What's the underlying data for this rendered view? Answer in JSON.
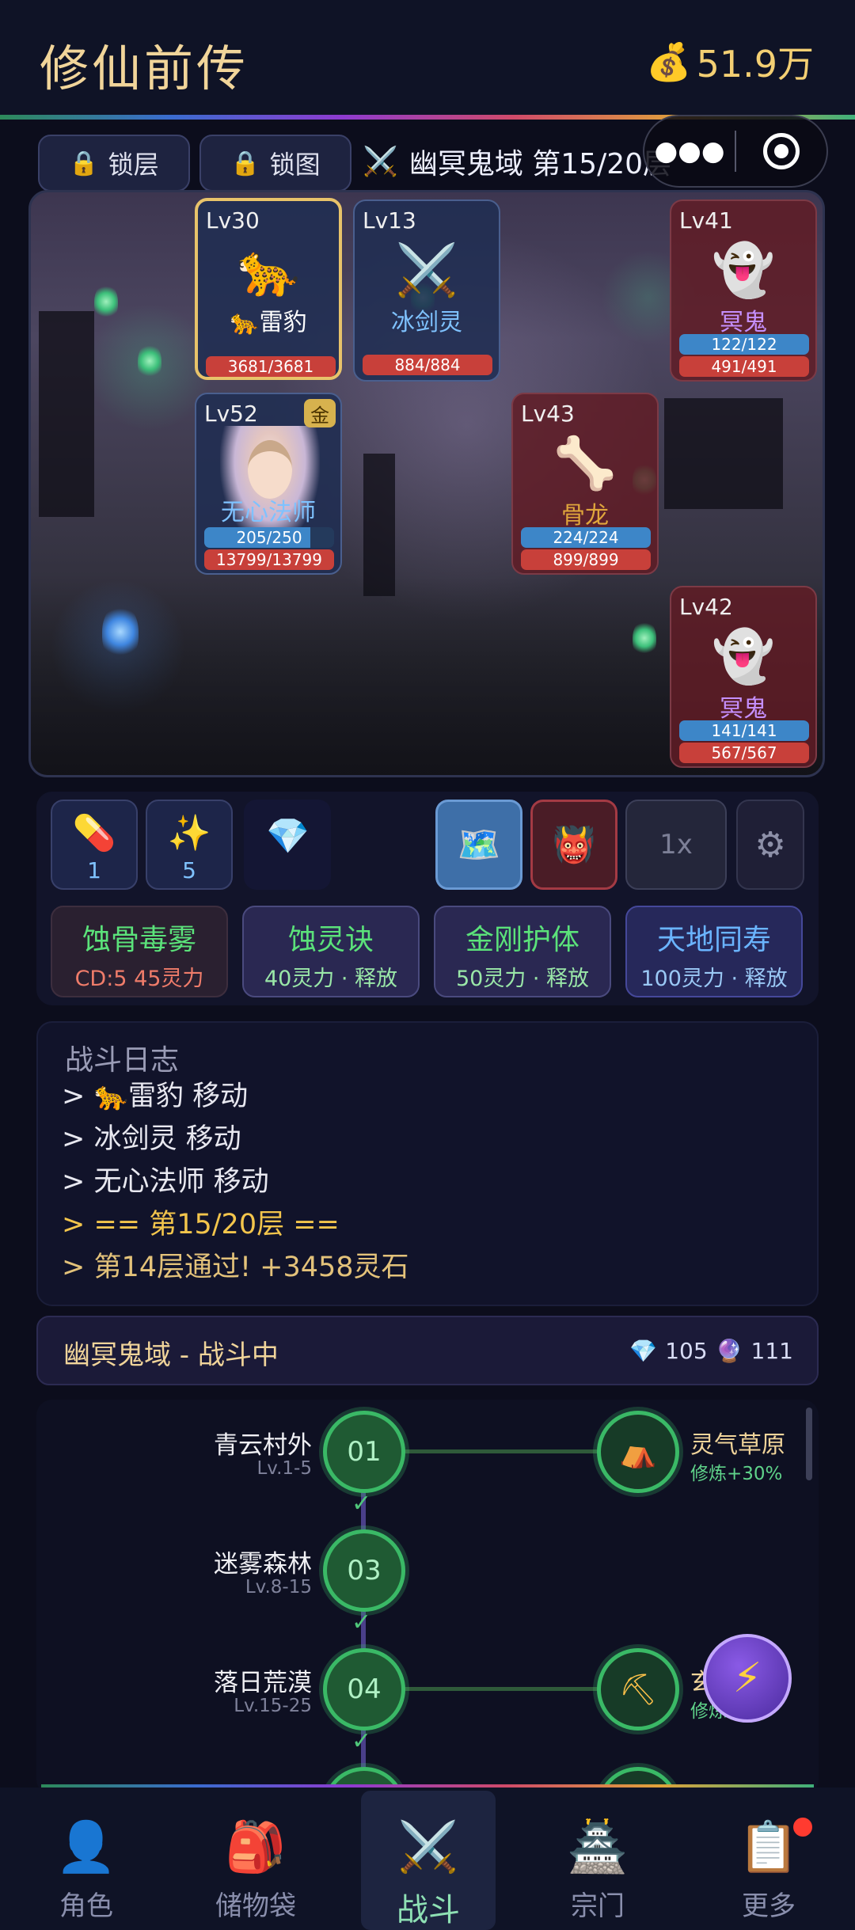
{
  "header": {
    "title": "修仙前传",
    "money_icon": "money-bag-icon",
    "money": "51.9万"
  },
  "controls": {
    "lock_floor": "锁层",
    "lock_map": "锁图",
    "level_title": "幽冥鬼域 第15/20层"
  },
  "units": [
    {
      "lv": "Lv30",
      "icon": "🐆",
      "name": "🐆雷豹",
      "hp": "3681/3681",
      "side": "ally"
    },
    {
      "lv": "Lv13",
      "icon": "⚔️",
      "name": "冰剑灵",
      "hp": "884/884",
      "side": "ally"
    },
    {
      "lv": "Lv41",
      "icon": "👻",
      "name": "冥鬼",
      "mp": "122/122",
      "hp": "491/491",
      "side": "enemy"
    },
    {
      "lv": "Lv52",
      "badge": "金",
      "name": "无心法师",
      "mp": "205/250",
      "hp": "13799/13799",
      "mp_frac": 0.82,
      "side": "ally"
    },
    {
      "lv": "Lv43",
      "icon": "🦴",
      "name": "骨龙",
      "mp": "224/224",
      "hp": "899/899",
      "side": "enemy"
    },
    {
      "lv": "Lv42",
      "icon": "👻",
      "name": "冥鬼",
      "mp": "141/141",
      "hp": "567/567",
      "side": "enemy"
    }
  ],
  "items": [
    {
      "icon": "💊",
      "count": "1"
    },
    {
      "icon": "✨",
      "count": "5"
    }
  ],
  "speed": "1x",
  "skills": [
    {
      "name": "蚀骨毒雾",
      "cost": "CD:5  45灵力"
    },
    {
      "name": "蚀灵诀",
      "cost": "40灵力 · 释放"
    },
    {
      "name": "金刚护体",
      "cost": "50灵力 · 释放"
    },
    {
      "name": "天地同寿",
      "cost": "100灵力 · 释放"
    }
  ],
  "log": {
    "title": "战斗日志",
    "lines": [
      "> 🐆雷豹 移动",
      "> 冰剑灵 移动",
      "> 无心法师 移动",
      "> == 第15/20层 ==",
      "> 第14层通过! +3458灵石"
    ]
  },
  "status": {
    "text": "幽冥鬼域 - 战斗中",
    "gems": "105",
    "orbs": "111"
  },
  "map": {
    "zones": [
      {
        "num": "01",
        "name": "青云村外",
        "lv": "Lv.1-5"
      },
      {
        "num": "03",
        "name": "迷雾森林",
        "lv": "Lv.8-15"
      },
      {
        "num": "04",
        "name": "落日荒漠",
        "lv": "Lv.15-25"
      }
    ],
    "side": [
      {
        "icon": "⛺",
        "name": "灵气草原",
        "bonus": "修炼+30%"
      },
      {
        "icon": "⛏",
        "name": "玄",
        "bonus": "修炼+3"
      }
    ]
  },
  "nav": [
    {
      "icon": "👤",
      "label": "角色"
    },
    {
      "icon": "🎒",
      "label": "储物袋"
    },
    {
      "icon": "⚔️",
      "label": "战斗"
    },
    {
      "icon": "🏯",
      "label": "宗门"
    },
    {
      "icon": "📋",
      "label": "更多"
    }
  ]
}
